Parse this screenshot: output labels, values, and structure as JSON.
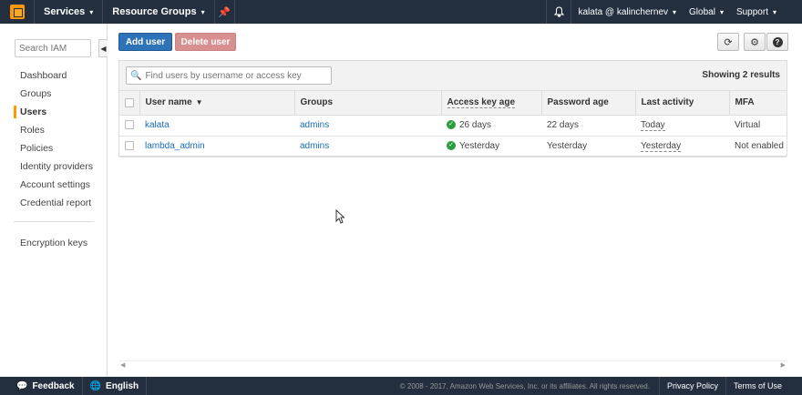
{
  "topnav": {
    "services_label": "Services",
    "resource_groups_label": "Resource Groups",
    "account_label": "kalata @ kalinchernev",
    "region_label": "Global",
    "support_label": "Support"
  },
  "sidebar": {
    "search_placeholder": "Search IAM",
    "items": [
      {
        "label": "Dashboard"
      },
      {
        "label": "Groups"
      },
      {
        "label": "Users"
      },
      {
        "label": "Roles"
      },
      {
        "label": "Policies"
      },
      {
        "label": "Identity providers"
      },
      {
        "label": "Account settings"
      },
      {
        "label": "Credential report"
      }
    ],
    "extra_item": "Encryption keys"
  },
  "toolbar": {
    "add_user_label": "Add user",
    "delete_user_label": "Delete user"
  },
  "filter": {
    "placeholder": "Find users by username or access key",
    "showing_text": "Showing 2 results"
  },
  "table": {
    "headers": [
      "User name",
      "Groups",
      "Access key age",
      "Password age",
      "Last activity",
      "MFA"
    ],
    "rows": [
      {
        "user": "kalata",
        "groups": "admins",
        "access_key_age": "26 days",
        "password_age": "22 days",
        "last_activity": "Today",
        "mfa": "Virtual"
      },
      {
        "user": "lambda_admin",
        "groups": "admins",
        "access_key_age": "Yesterday",
        "password_age": "Yesterday",
        "last_activity": "Yesterday",
        "mfa": "Not enabled"
      }
    ]
  },
  "footer": {
    "feedback_label": "Feedback",
    "language_label": "English",
    "copyright": "© 2008 - 2017, Amazon Web Services, Inc. or its affiliates. All rights reserved.",
    "privacy_label": "Privacy Policy",
    "terms_label": "Terms of Use"
  },
  "colors": {
    "nav_bg": "#232f3e",
    "primary": "#2e73b8",
    "danger_disabled": "#d88f8f",
    "accent": "#ff9900",
    "link": "#1a6bb8",
    "ok": "#2a9d3c"
  }
}
